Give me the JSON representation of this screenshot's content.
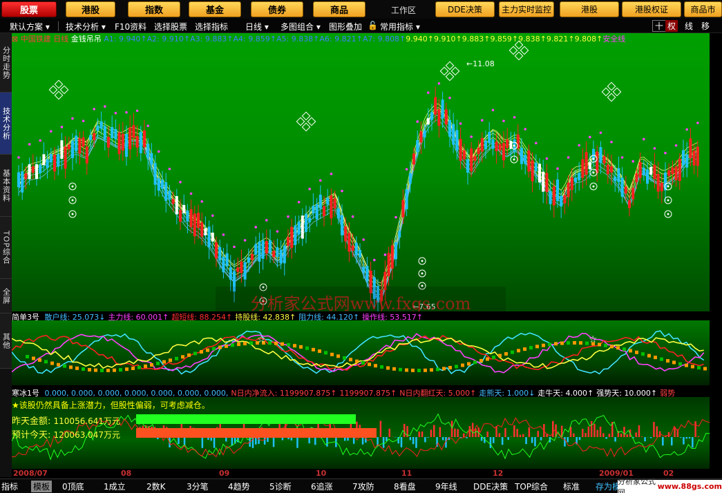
{
  "topbar": {
    "buttons": [
      "股票",
      "港股",
      "指数",
      "基金",
      "债券",
      "商品"
    ],
    "workspace_label": "工作区",
    "right_buttons": [
      "DDE决策",
      "主力实时监控",
      "港股",
      "港股权证",
      "商品市"
    ]
  },
  "toolbar": {
    "items": [
      "默认方案",
      "技术分析",
      "F10资料",
      "选择股票",
      "选择指标",
      "日线",
      "多图组合",
      "图形叠加",
      "常用指标"
    ],
    "right": [
      "十",
      "权",
      "线",
      "移"
    ]
  },
  "vtabs": [
    "分时走势",
    "技术分析",
    "基本资料",
    "TOP综合",
    "全屏",
    "其他"
  ],
  "main": {
    "stock_name": "中国铁建",
    "period": "日线",
    "indicator": "金钱吊吊",
    "legend": [
      {
        "label": "A1: 9.940",
        "arrow": "↑",
        "color": "#4080ff"
      },
      {
        "label": "A2: 9.910",
        "arrow": "↑",
        "color": "#4080ff"
      },
      {
        "label": "A3: 9.883",
        "arrow": "↑",
        "color": "#4080ff"
      },
      {
        "label": "A4: 9.859",
        "arrow": "↑",
        "color": "#4080ff"
      },
      {
        "label": "A5: 9.838",
        "arrow": "↑",
        "color": "#4080ff"
      },
      {
        "label": "A6: 9.821",
        "arrow": "↑",
        "color": "#4080ff"
      },
      {
        "label": "A7: 9.808",
        "arrow": "↑",
        "color": "#4080ff"
      },
      {
        "label": "9.940",
        "arrow": "↑",
        "color": "#ffff40"
      },
      {
        "label": "9.910",
        "arrow": "↑",
        "color": "#ffff40"
      },
      {
        "label": "9.883",
        "arrow": "↑",
        "color": "#ffff40"
      },
      {
        "label": "9.859",
        "arrow": "↑",
        "color": "#ffff40"
      },
      {
        "label": "9.838",
        "arrow": "↑",
        "color": "#ffff40"
      },
      {
        "label": "9.821",
        "arrow": "↑",
        "color": "#ffff40"
      },
      {
        "label": "9.808",
        "arrow": "↑",
        "color": "#ffff40"
      },
      {
        "label": "安全线",
        "arrow": "",
        "color": "#ff40ff"
      }
    ],
    "high_label": "11.08",
    "low_label": "7.65"
  },
  "watermark": "分析家公式网www.fxgs.com",
  "ind1": {
    "name": "简单3号",
    "items": [
      {
        "label": "散户线: 25.073↓",
        "color": "#40c0ff"
      },
      {
        "label": "主力线: 60.001↑",
        "color": "#ff40ff"
      },
      {
        "label": "超短线: 88.254↑",
        "color": "#ff3030"
      },
      {
        "label": "持股线: 42.838↑",
        "color": "#ffff40"
      },
      {
        "label": "阻力线: 44.120↑",
        "color": "#40c0ff"
      },
      {
        "label": "操作线: 53.517↑",
        "color": "#ff40ff"
      }
    ]
  },
  "ind2": {
    "name": "寒冰1号",
    "items": [
      {
        "label": "0.000, 0.000, 0.000, 0.000, 0.000, 0.000, 0.000,",
        "color": "#40c0ff"
      },
      {
        "label": "N日内净流入: 1199907.875↑",
        "color": "#ff4040"
      },
      {
        "label": "1199907.875↑",
        "color": "#ff4040"
      },
      {
        "label": "N日内翻红天: 5.000↑",
        "color": "#ff4040"
      },
      {
        "label": "走熊天: 1.000↓",
        "color": "#40c0ff"
      },
      {
        "label": "走牛天: 4.000↑",
        "color": "#ffffff"
      },
      {
        "label": "强势天: 10.000↑",
        "color": "#ffffff"
      },
      {
        "label": "弱势",
        "color": "#ff4040"
      }
    ]
  },
  "vol": {
    "warning": "★该股仍然具备上涨潜力，但股性偏弱，可考虑减仓。",
    "yesterday_label": "昨天金额:",
    "yesterday_value": "110056.641万元",
    "today_label": "预计今天:",
    "today_value": "120063.047万元"
  },
  "dates": [
    "2008/07",
    "08",
    "09",
    "10",
    "11",
    "12",
    "2009/01",
    "02"
  ],
  "bottom_tabs": [
    "指标",
    "模板",
    "0顶底",
    "1成立",
    "2数K",
    "3分笔",
    "4趋势",
    "5诊断",
    "6追涨",
    "7攻防",
    "8看盘",
    "9年线",
    "DDE决策",
    "TOP综合",
    "标准",
    "存为模"
  ],
  "site_badge": {
    "prefix": "分析家公式网",
    "url": "www.88gs.com"
  },
  "colors": {
    "up": "#ff2020",
    "down": "#20c0ff",
    "bg_green": "#00a000",
    "cloud_yellow": "#ffff80",
    "cloud_blue": "#80c0ff",
    "dots": "#ff40ff"
  }
}
